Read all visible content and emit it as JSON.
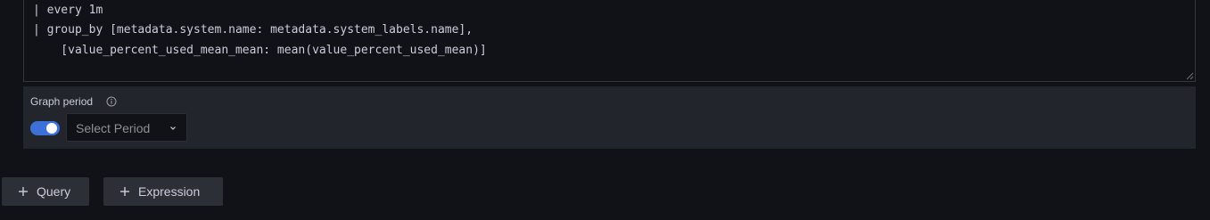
{
  "editor": {
    "lines": [
      "| every 1m",
      "| group_by [metadata.system.name: metadata.system_labels.name],",
      "    [value_percent_used_mean_mean: mean(value_percent_used_mean)]"
    ]
  },
  "options": {
    "graph_period_label": "Graph period",
    "toggle_on": true,
    "period_select_placeholder": "Select Period"
  },
  "buttons": {
    "query_label": "Query",
    "expression_label": "Expression"
  },
  "colors": {
    "background": "#111217",
    "panel": "#22252b",
    "accent": "#3d71d9",
    "text": "#ccccdc"
  },
  "icons": {
    "info": "info-icon",
    "chevron": "chevron-down-icon",
    "plus": "plus-icon"
  }
}
